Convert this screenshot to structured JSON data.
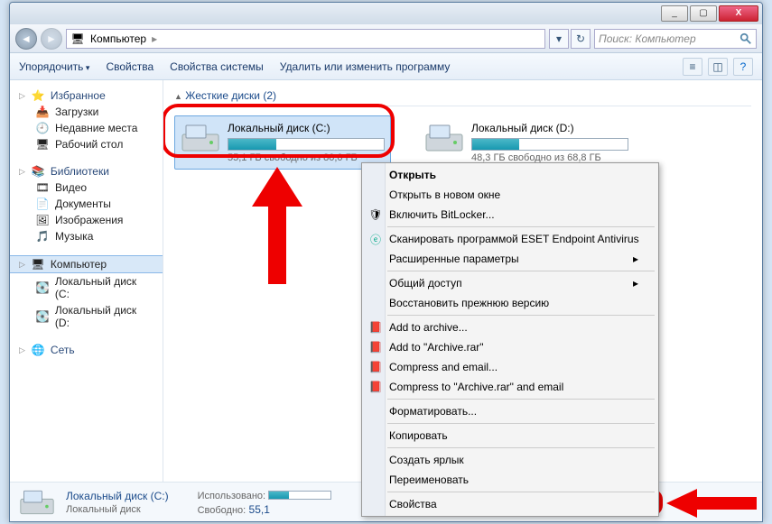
{
  "titlebar": {
    "min": "_",
    "max": "▢",
    "close": "X"
  },
  "nav": {
    "crumb_root_icon": "🖥",
    "crumb_root": "Компьютер",
    "search_placeholder": "Поиск: Компьютер"
  },
  "toolbar": {
    "organize": "Упорядочить",
    "props": "Свойства",
    "sysprops": "Свойства системы",
    "uninstall": "Удалить или изменить программу"
  },
  "sidebar": {
    "fav": {
      "h": "Избранное",
      "items": [
        "Загрузки",
        "Недавние места",
        "Рабочий стол"
      ]
    },
    "lib": {
      "h": "Библиотеки",
      "items": [
        "Видео",
        "Документы",
        "Изображения",
        "Музыка"
      ]
    },
    "comp": {
      "h": "Компьютер",
      "items": [
        "Локальный диск (C:",
        "Локальный диск (D:"
      ]
    },
    "net": {
      "h": "Сеть"
    }
  },
  "main": {
    "section": "Жесткие диски (2)",
    "drives": [
      {
        "name": "Локальный диск (C:)",
        "free": "55,1 ГБ свободно из 80,0 ГБ",
        "pct": 31
      },
      {
        "name": "Локальный диск (D:)",
        "free": "48,3 ГБ свободно из 68,8 ГБ",
        "pct": 30
      }
    ]
  },
  "context": {
    "open": "Открыть",
    "open_new": "Открыть в новом окне",
    "bitlocker": "Включить BitLocker...",
    "eset": "Сканировать программой ESET Endpoint Antivirus",
    "adv": "Расширенные параметры",
    "share": "Общий доступ",
    "restore": "Восстановить прежнюю версию",
    "add_arch": "Add to archive...",
    "add_rar": "Add to \"Archive.rar\"",
    "comp_email": "Compress and email...",
    "comp_rar_email": "Compress to \"Archive.rar\" and email",
    "format": "Форматировать...",
    "copy": "Копировать",
    "shortcut": "Создать ярлык",
    "rename": "Переименовать",
    "properties": "Свойства"
  },
  "status": {
    "title": "Локальный диск (C:)",
    "sub": "Локальный диск",
    "used_lab": "Использовано:",
    "free_lab": "Свободно:",
    "free_val": "55,1"
  }
}
